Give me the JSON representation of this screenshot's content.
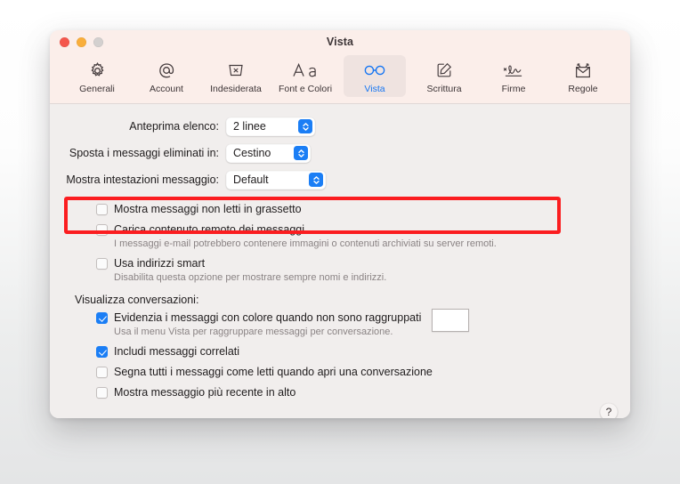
{
  "window": {
    "title": "Vista",
    "traffic_lights": [
      {
        "name": "close",
        "color": "#f4564c"
      },
      {
        "name": "minimize",
        "color": "#f9ae3b"
      },
      {
        "name": "zoom",
        "color": "#d3d0cf"
      }
    ]
  },
  "toolbar": {
    "tabs": [
      {
        "label": "Generali",
        "icon": "gear-icon",
        "selected": false
      },
      {
        "label": "Account",
        "icon": "at-sign-icon",
        "selected": false
      },
      {
        "label": "Indesiderata",
        "icon": "junk-bin-icon",
        "selected": false
      },
      {
        "label": "Font e Colori",
        "icon": "font-aa-icon",
        "selected": false
      },
      {
        "label": "Vista",
        "icon": "glasses-icon",
        "selected": true
      },
      {
        "label": "Scrittura",
        "icon": "compose-pencil-icon",
        "selected": false
      },
      {
        "label": "Firme",
        "icon": "signature-icon",
        "selected": false
      },
      {
        "label": "Regole",
        "icon": "rules-envelope-icon",
        "selected": false
      }
    ],
    "selected_color": "#1676f3"
  },
  "settings": {
    "popup_rows": [
      {
        "label": "Anteprima elenco:",
        "value": "2 linee",
        "label_width": 110,
        "popup_width": 100
      },
      {
        "label": "Sposta i messaggi eliminati in:",
        "value": "Cestino",
        "label_width": 185,
        "popup_width": 95
      },
      {
        "label": "Mostra intestazioni messaggio:",
        "value": "Default",
        "label_width": 192,
        "popup_width": 110
      }
    ],
    "checkboxes_top": [
      {
        "label": "Mostra messaggi non letti in grassetto",
        "checked": false,
        "sub": ""
      },
      {
        "label": "Carica contenuto remoto dei messaggi",
        "checked": false,
        "sub": "I messaggi e-mail potrebbero contenere immagini o contenuti archiviati su server remoti."
      },
      {
        "label": "Usa indirizzi smart",
        "checked": false,
        "sub": "Disabilita questa opzione per mostrare sempre nomi e indirizzi."
      }
    ],
    "conversations_label": "Visualizza conversazioni:",
    "checkboxes_conversations": [
      {
        "label": "Evidenzia i messaggi con colore quando non sono raggruppati",
        "checked": true,
        "sub": "Usa il menu Vista per raggruppare messaggi per conversazione.",
        "has_swatch": true
      },
      {
        "label": "Includi messaggi correlati",
        "checked": true,
        "sub": "",
        "has_swatch": false
      },
      {
        "label": "Segna tutti i messaggi come letti quando apri una conversazione",
        "checked": false,
        "sub": "",
        "has_swatch": false
      },
      {
        "label": "Mostra messaggio più recente in alto",
        "checked": false,
        "sub": "",
        "has_swatch": false
      }
    ],
    "help_label": "?"
  },
  "annotation": {
    "highlight_color": "#fb1d20",
    "target": "Carica contenuto remoto dei messaggi"
  }
}
